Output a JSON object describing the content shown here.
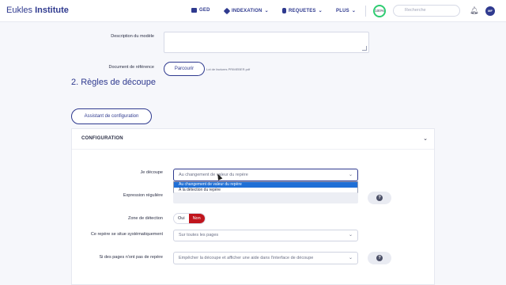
{
  "app": {
    "logo_light": "Eukles ",
    "logo_bold": "Institute"
  },
  "nav": {
    "items": [
      {
        "label": "GED",
        "icon": "monitor-icon",
        "chevron": false
      },
      {
        "label": "INDEXATION",
        "icon": "tag-icon",
        "chevron": true
      },
      {
        "label": "REQUETES",
        "icon": "database-icon",
        "chevron": true
      },
      {
        "label": "PLUS",
        "icon": "",
        "chevron": true
      }
    ],
    "badge": "100%",
    "search_placeholder": "Recherche",
    "avatar_initials": "MF"
  },
  "form": {
    "description_label": "Description du modèle",
    "reference_label": "Document de référence",
    "browse_button": "Parcourir",
    "file_name": "Lot de factures PRIMEBER.pdf",
    "section_title": "2. Règles de découpe",
    "wizard_button": "Assistant de configuration"
  },
  "config": {
    "title": "CONFIGURATION",
    "cut_label": "Je découpe",
    "cut_value": "Au changement de valeur du repère",
    "cut_options": [
      {
        "label": "Au changement de valeur du repère",
        "selected": true
      },
      {
        "label": "À la détection du repère",
        "selected": false
      }
    ],
    "regex_label": "Expression régulière",
    "zone_label": "Zone de détection",
    "toggle_yes": "Oui",
    "toggle_no": "Non",
    "toggle_active": "Non",
    "systematic_label": "Ce repère se situe systématiquement",
    "systematic_value": "Sur toutes les pages",
    "missing_label": "Si des pages n'ont pas de repère",
    "missing_value": "Empêcher la découpe et afficher une aide dans l'interface de découpe",
    "help_symbol": "?"
  },
  "colors": {
    "brand": "#2f3a8f",
    "danger": "#c0141c",
    "selection": "#1f6fd6",
    "success": "#2ecc71"
  }
}
